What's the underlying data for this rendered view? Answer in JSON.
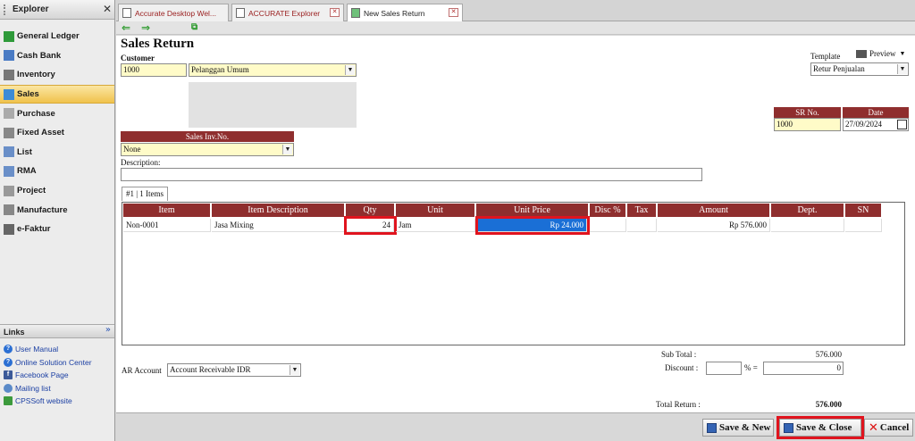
{
  "explorer": {
    "title": "Explorer",
    "items": [
      {
        "label": "General Ledger",
        "icon": "ledger-icon"
      },
      {
        "label": "Cash Bank",
        "icon": "bank-icon"
      },
      {
        "label": "Inventory",
        "icon": "inventory-icon"
      },
      {
        "label": "Sales",
        "icon": "sales-icon"
      },
      {
        "label": "Purchase",
        "icon": "cart-icon"
      },
      {
        "label": "Fixed Asset",
        "icon": "building-icon"
      },
      {
        "label": "List",
        "icon": "list-icon"
      },
      {
        "label": "RMA",
        "icon": "rma-icon"
      },
      {
        "label": "Project",
        "icon": "project-icon"
      },
      {
        "label": "Manufacture",
        "icon": "factory-icon"
      },
      {
        "label": "e-Faktur",
        "icon": "efaktur-icon"
      }
    ],
    "active": "Sales"
  },
  "links": {
    "title": "Links",
    "items": [
      "User Manual",
      "Online Solution Center",
      "Facebook Page",
      "Mailing list",
      "CPSSoft website"
    ]
  },
  "tabs": [
    "Accurate Desktop Wel...",
    "ACCURATE Explorer",
    "New Sales Return"
  ],
  "form": {
    "title": "Sales Return",
    "customer_label": "Customer",
    "customer_id": "1000",
    "customer_name": "Pelanggan Umum",
    "template_label": "Template",
    "preview_label": "Preview",
    "template_value": "Retur Penjualan",
    "sr_no_label": "SR No.",
    "sr_no": "1000",
    "date_label": "Date",
    "date": "27/09/2024",
    "sales_inv_label": "Sales Inv.No.",
    "sales_inv": "None",
    "description_label": "Description:",
    "items_tab": "#1 | 1 Items",
    "ar_account_label": "AR Account",
    "ar_account": "Account Receivable IDR",
    "subtotal_label": "Sub Total :",
    "subtotal": "576.000",
    "discount_label": "Discount :",
    "discount_pct_sep": "% =",
    "discount_value": "0",
    "total_label": "Total Return :",
    "total": "576.000"
  },
  "grid": {
    "columns": [
      "Item",
      "Item Description",
      "Qty",
      "Unit",
      "Unit Price",
      "Disc %",
      "Tax",
      "Amount",
      "Dept.",
      "SN"
    ],
    "rows": [
      {
        "item": "Non-0001",
        "desc": "Jasa Mixing",
        "qty": "24",
        "unit": "Jam",
        "price": "Rp 24.000",
        "disc": "",
        "tax": "",
        "amount": "Rp 576.000",
        "dept": "",
        "sn": ""
      }
    ]
  },
  "buttons": {
    "save_new": "Save & New",
    "save_close": "Save & Close",
    "cancel": "Cancel"
  },
  "colors": {
    "accent": "#8f2e2e",
    "highlight": "#e0141e",
    "field": "#fffbc8"
  }
}
